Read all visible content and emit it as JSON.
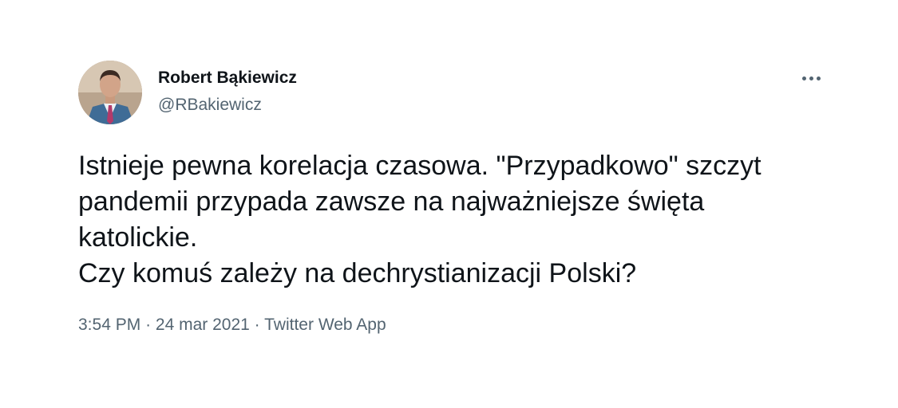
{
  "author": {
    "name": "Robert Bąkiewicz",
    "handle": "@RBakiewicz"
  },
  "tweet": {
    "lines": [
      "Istnieje pewna korelacja czasowa. \"Przypadkowo\" szczyt",
      "pandemii przypada zawsze na najważniejsze święta",
      "katolickie.",
      "Czy komuś zależy na dechrystianizacji Polski?"
    ]
  },
  "meta": {
    "time": "3:54 PM",
    "separator": "·",
    "date": "24 mar 2021",
    "source": "Twitter Web App"
  },
  "icons": {
    "more": "more-horizontal-icon"
  },
  "colors": {
    "text": "#0f1419",
    "secondary": "#536471",
    "background": "#ffffff"
  }
}
